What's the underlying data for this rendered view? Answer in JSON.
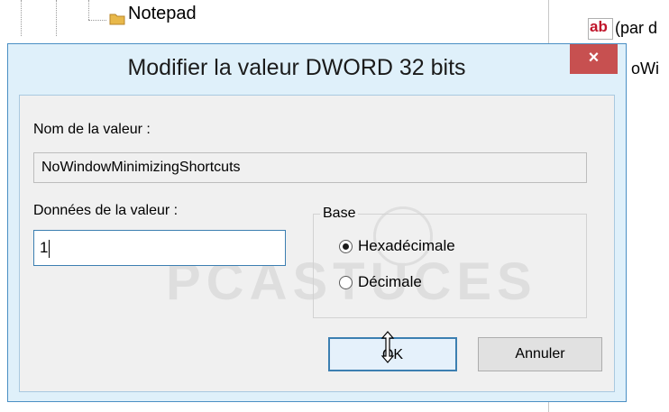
{
  "background": {
    "tree_item": "Notepad",
    "right_pane_value_type_icon": "string-value-icon",
    "right_pane_value_type_label": "ab",
    "right_pane_text_1": "(par d",
    "right_pane_text_2": "oWi"
  },
  "dialog": {
    "title": "Modifier la valeur DWORD 32 bits",
    "close_label": "×",
    "value_name_label": "Nom de la valeur :",
    "value_name": "NoWindowMinimizingShortcuts",
    "value_data_label": "Données de la valeur :",
    "value_data": "1",
    "base": {
      "label": "Base",
      "options": [
        {
          "label": "Hexadécimale",
          "selected": true
        },
        {
          "label": "Décimale",
          "selected": false
        }
      ]
    },
    "ok_label": "OK",
    "cancel_label": "Annuler"
  },
  "watermark": "PCASTUCES",
  "colors": {
    "close_button": "#c75050",
    "focus_border": "#3c7fb1",
    "dialog_frame": "#dff0fa"
  }
}
